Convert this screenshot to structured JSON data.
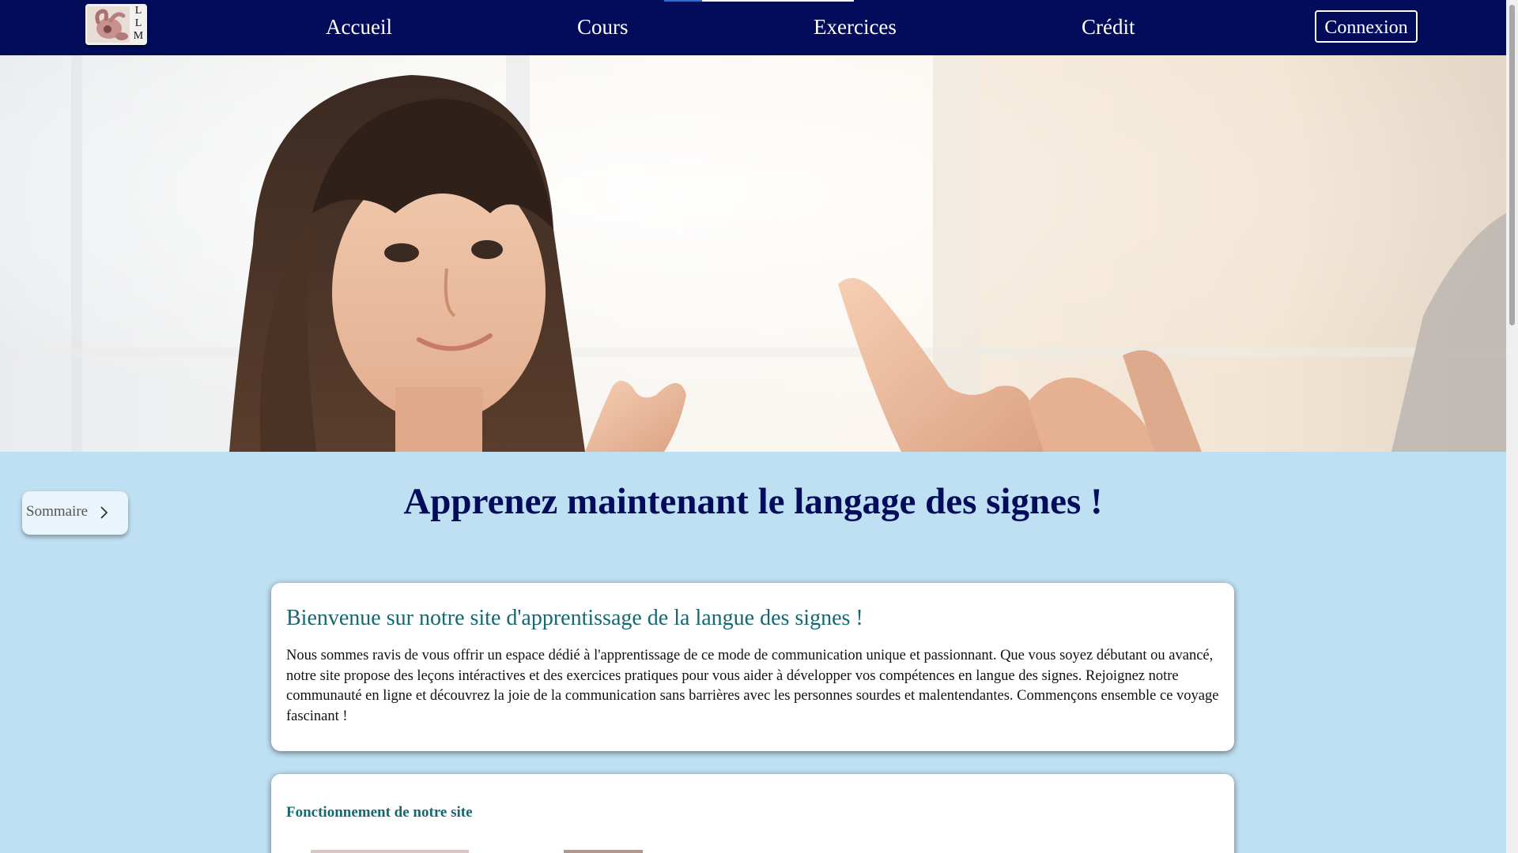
{
  "nav": {
    "logo_letters": [
      "L",
      "L",
      "M"
    ],
    "links": [
      {
        "label": "Accueil"
      },
      {
        "label": "Cours"
      },
      {
        "label": "Exercices"
      },
      {
        "label": "Crédit"
      }
    ],
    "login_label": "Connexion"
  },
  "hero": {
    "image": "photo-girl-sign-language"
  },
  "sommaire": {
    "label": "Sommaire",
    "icon": "chevron-right-icon"
  },
  "main": {
    "title": "Apprenez maintenant le langage des signes !",
    "intro": {
      "heading": "Bienvenue sur notre site d'apprentissage de la langue des signes !",
      "body": "Nous sommes ravis de vous offrir un espace dédié à l'apprentissage de ce mode de communication unique et passionnant. Que vous soyez débutant ou avancé, notre site propose des leçons intéractives et des exercices pratiques pour vous aider à développer vos compétences en langue des signes. Rejoignez notre communauté en ligne et découvrez la joie de la communication sans barrières avec les personnes sourdes et malentendantes. Commençons ensemble ce voyage fascinant !"
    },
    "section2": {
      "heading": "Fonctionnement de notre site"
    }
  },
  "colors": {
    "nav_bg": "#020c5a",
    "page_bg": "#bfe0f3",
    "title": "#020c5a",
    "card_heading": "#156772"
  }
}
